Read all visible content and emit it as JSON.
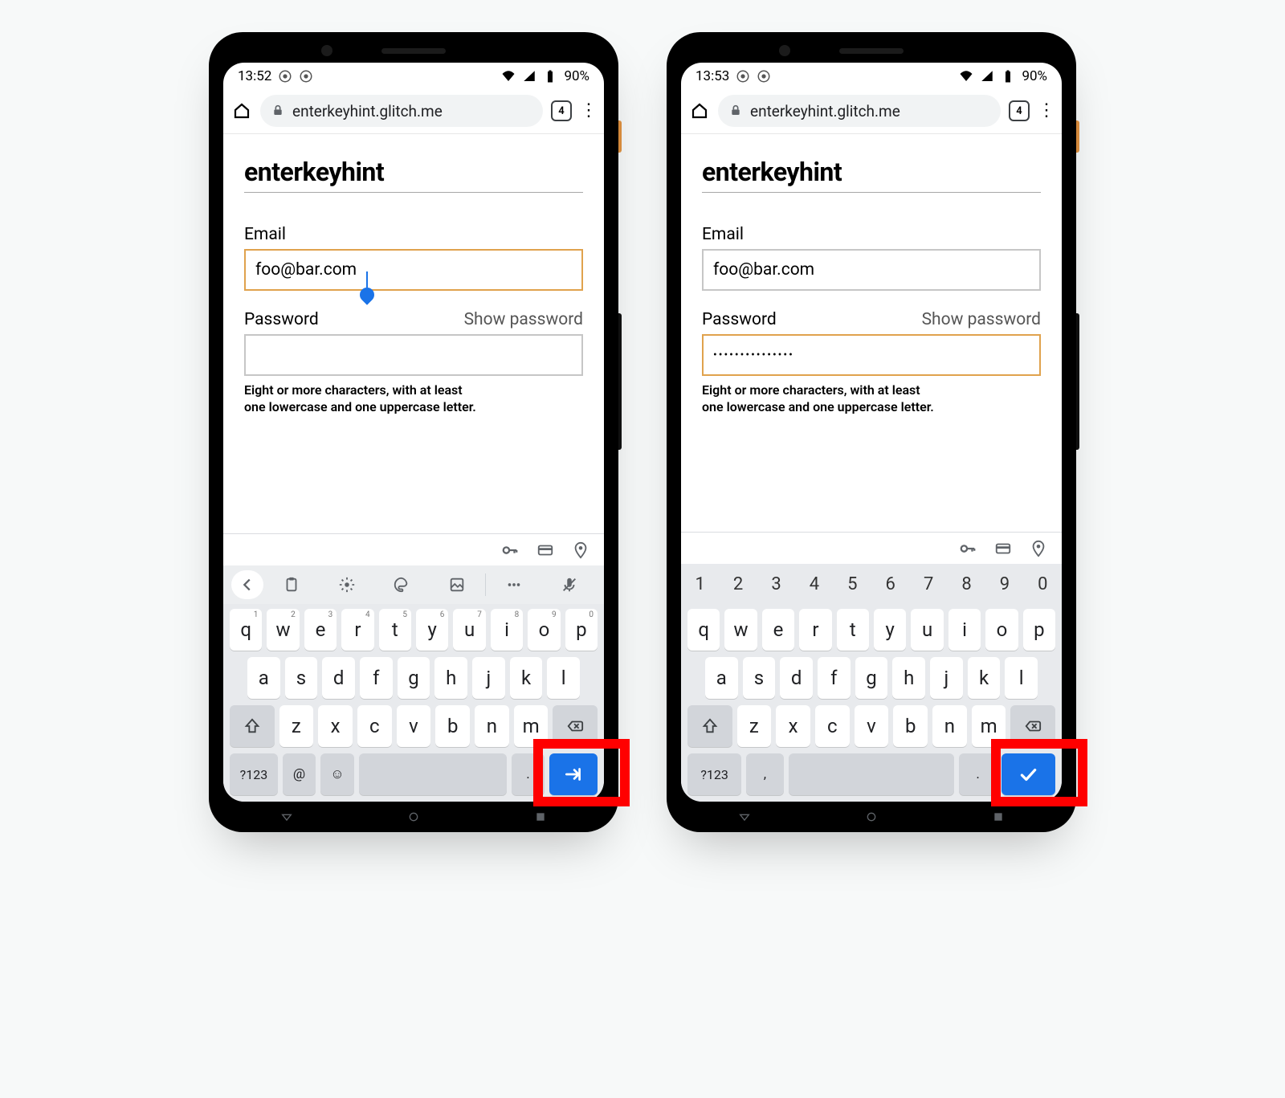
{
  "phones": [
    {
      "status": {
        "time": "13:52",
        "battery": "90%"
      },
      "url": "enterkeyhint.glitch.me",
      "tabs": "4",
      "page_title": "enterkeyhint",
      "email_label": "Email",
      "email_value": "foo@bar.com",
      "email_focused": true,
      "password_label": "Password",
      "password_value": "",
      "password_focused": false,
      "show_password": "Show password",
      "hint_l1": "Eight or more characters, with at least",
      "hint_l2": "one lowercase and one uppercase letter.",
      "has_toolbar": true,
      "has_numrow": false,
      "enter_icon": "next",
      "sym_key": "?123",
      "extra_key": "@",
      "extra_key2": "☺",
      "dot_key": ".",
      "keys_row1": [
        {
          "k": "q",
          "sup": "1"
        },
        {
          "k": "w",
          "sup": "2"
        },
        {
          "k": "e",
          "sup": "3"
        },
        {
          "k": "r",
          "sup": "4"
        },
        {
          "k": "t",
          "sup": "5"
        },
        {
          "k": "y",
          "sup": "6"
        },
        {
          "k": "u",
          "sup": "7"
        },
        {
          "k": "i",
          "sup": "8"
        },
        {
          "k": "o",
          "sup": "9"
        },
        {
          "k": "p",
          "sup": "0"
        }
      ],
      "keys_row2": [
        "a",
        "s",
        "d",
        "f",
        "g",
        "h",
        "j",
        "k",
        "l"
      ],
      "keys_row3": [
        "z",
        "x",
        "c",
        "v",
        "b",
        "n",
        "m"
      ]
    },
    {
      "status": {
        "time": "13:53",
        "battery": "90%"
      },
      "url": "enterkeyhint.glitch.me",
      "tabs": "4",
      "page_title": "enterkeyhint",
      "email_label": "Email",
      "email_value": "foo@bar.com",
      "email_focused": false,
      "password_label": "Password",
      "password_value": "•••••••••••••••",
      "password_focused": true,
      "show_password": "Show password",
      "hint_l1": "Eight or more characters, with at least",
      "hint_l2": "one lowercase and one uppercase letter.",
      "has_toolbar": false,
      "has_numrow": true,
      "numrow": [
        "1",
        "2",
        "3",
        "4",
        "5",
        "6",
        "7",
        "8",
        "9",
        "0"
      ],
      "enter_icon": "done",
      "sym_key": "?123",
      "extra_key": ",",
      "extra_key2": "",
      "dot_key": ".",
      "keys_row1": [
        {
          "k": "q",
          "sup": ""
        },
        {
          "k": "w",
          "sup": ""
        },
        {
          "k": "e",
          "sup": ""
        },
        {
          "k": "r",
          "sup": ""
        },
        {
          "k": "t",
          "sup": ""
        },
        {
          "k": "y",
          "sup": ""
        },
        {
          "k": "u",
          "sup": ""
        },
        {
          "k": "i",
          "sup": ""
        },
        {
          "k": "o",
          "sup": ""
        },
        {
          "k": "p",
          "sup": ""
        }
      ],
      "keys_row2": [
        "a",
        "s",
        "d",
        "f",
        "g",
        "h",
        "j",
        "k",
        "l"
      ],
      "keys_row3": [
        "z",
        "x",
        "c",
        "v",
        "b",
        "n",
        "m"
      ]
    }
  ]
}
